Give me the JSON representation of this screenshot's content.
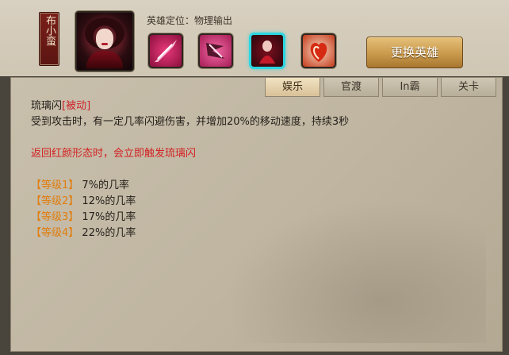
{
  "hero": {
    "name": "布小蛮",
    "role_label": "英雄定位：物理输出"
  },
  "skills": [
    {
      "icon": "slash-skill-icon"
    },
    {
      "icon": "strike-skill-icon"
    },
    {
      "icon": "shadow-skill-icon",
      "selected": true
    },
    {
      "icon": "flame-heart-skill-icon"
    }
  ],
  "change_hero_button": "更换英雄",
  "tabs": [
    {
      "label": "娱乐",
      "active": true
    },
    {
      "label": "官渡"
    },
    {
      "label": "In霸"
    },
    {
      "label": "关卡"
    }
  ],
  "skill_detail": {
    "name": "琉璃闪",
    "type_tag": "[被动]",
    "description": "受到攻击时，有一定几率闪避伤害，并增加20%的移动速度，持续3秒",
    "note": "返回红颜形态时，会立即触发琉璃闪",
    "levels": [
      {
        "tag": "【等级1】",
        "text": "7%的几率"
      },
      {
        "tag": "【等级2】",
        "text": "12%的几率"
      },
      {
        "tag": "【等级3】",
        "text": "17%的几率"
      },
      {
        "tag": "【等级4】",
        "text": "22%的几率"
      }
    ]
  },
  "colors": {
    "passive_tag": "#d0202a",
    "note": "#d32222",
    "level_tag": "#e07d0e",
    "selected_skill_border": "#2ad6e0"
  }
}
